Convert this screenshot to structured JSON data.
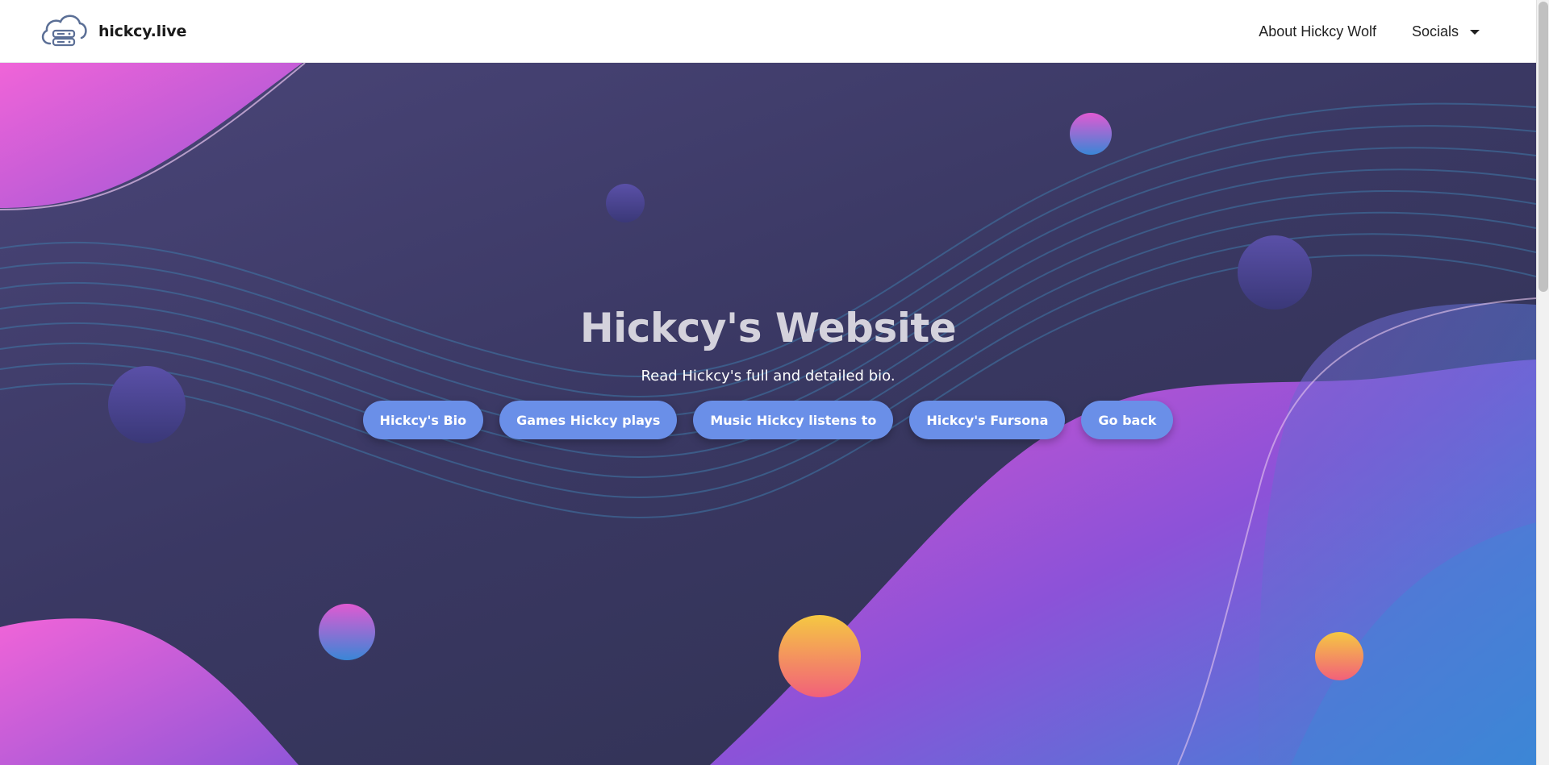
{
  "navbar": {
    "brand_name": "hickcy.live",
    "brand_icon": "cloud-server-icon",
    "links": [
      {
        "label": "About Hickcy Wolf"
      },
      {
        "label": "Socials",
        "icon": "caret-down-icon"
      }
    ]
  },
  "hero": {
    "title": "Hickcy's Website",
    "subtitle": "Read Hickcy's full and detailed bio.",
    "buttons": [
      {
        "label": "Hickcy's Bio"
      },
      {
        "label": "Games Hickcy plays"
      },
      {
        "label": "Music Hickcy listens to"
      },
      {
        "label": "Hickcy's Fursona"
      },
      {
        "label": "Go back"
      }
    ]
  },
  "colors": {
    "button_bg": "#6a8fe8",
    "hero_bg": "#3a3863",
    "pink": "#f064d8",
    "purple": "#8c52d8",
    "blue": "#3a86d6",
    "orange": "#f5c842"
  }
}
